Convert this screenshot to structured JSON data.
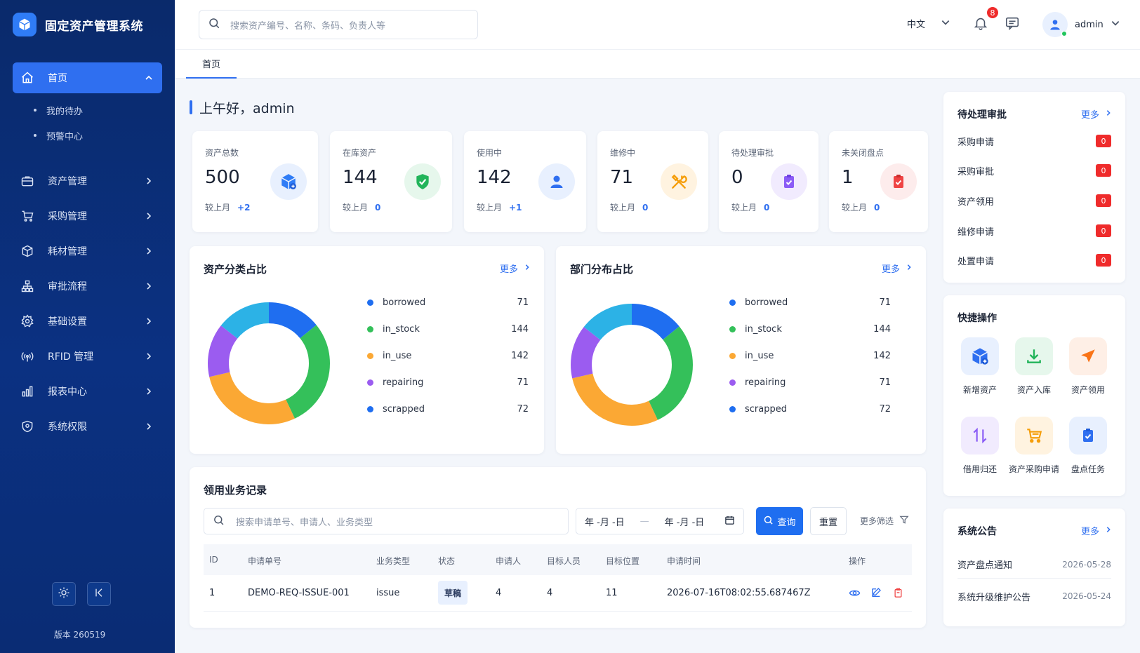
{
  "app": {
    "title": "固定资产管理系统",
    "version": "版本 260519"
  },
  "sidebar": {
    "items": [
      {
        "label": "首页",
        "icon": "home-icon",
        "active": true,
        "children": [
          "我的待办",
          "预警中心"
        ]
      },
      {
        "label": "资产管理",
        "icon": "briefcase-icon"
      },
      {
        "label": "采购管理",
        "icon": "cart-icon"
      },
      {
        "label": "耗材管理",
        "icon": "box-icon"
      },
      {
        "label": "审批流程",
        "icon": "flow-icon"
      },
      {
        "label": "基础设置",
        "icon": "gear-icon"
      },
      {
        "label": "RFID 管理",
        "icon": "rfid-icon"
      },
      {
        "label": "报表中心",
        "icon": "chart-icon"
      },
      {
        "label": "系统权限",
        "icon": "shield-icon"
      }
    ]
  },
  "header": {
    "search_placeholder": "搜索资产编号、名称、条码、负责人等",
    "language": "中文",
    "notification_count": "8",
    "user": "admin"
  },
  "tabs": [
    "首页"
  ],
  "greeting": "上午好，admin",
  "stats": [
    {
      "label": "资产总数",
      "value": "500",
      "compare_label": "较上月",
      "delta": "+2",
      "icon": "cube-icon",
      "color": "#2f7cf6",
      "bg": "#e8f0fe"
    },
    {
      "label": "在库资产",
      "value": "144",
      "compare_label": "较上月",
      "delta": "0",
      "icon": "shield-check-icon",
      "color": "#22b45a",
      "bg": "#e6f7ec"
    },
    {
      "label": "使用中",
      "value": "142",
      "compare_label": "较上月",
      "delta": "+1",
      "icon": "user-icon",
      "color": "#2f6ff0",
      "bg": "#e8f0fe"
    },
    {
      "label": "维修中",
      "value": "71",
      "compare_label": "较上月",
      "delta": "0",
      "icon": "tools-icon",
      "color": "#f59e0b",
      "bg": "#fff3e0"
    },
    {
      "label": "待处理审批",
      "value": "0",
      "compare_label": "较上月",
      "delta": "0",
      "icon": "clipboard-check-icon",
      "color": "#8b5cf6",
      "bg": "#f1ebfe"
    },
    {
      "label": "未关闭盘点",
      "value": "1",
      "compare_label": "较上月",
      "delta": "0",
      "icon": "clipboard-alert-icon",
      "color": "#ef4444",
      "bg": "#fdecec"
    }
  ],
  "more_label": "更多",
  "chart_data": [
    {
      "type": "pie",
      "title": "资产分类占比",
      "categories": [
        "borrowed",
        "in_stock",
        "in_use",
        "repairing",
        "scrapped"
      ],
      "values": [
        71,
        144,
        142,
        71,
        72
      ],
      "colors": [
        "#1f6ef0",
        "#34c05a",
        "#fba834",
        "#9b5cf0",
        "#2cb2e6"
      ],
      "legend_colors": [
        "#1f6ef0",
        "#34c05a",
        "#fba834",
        "#9b5cf0",
        "#1f6ef0"
      ]
    },
    {
      "type": "pie",
      "title": "部门分布占比",
      "categories": [
        "borrowed",
        "in_stock",
        "in_use",
        "repairing",
        "scrapped"
      ],
      "values": [
        71,
        144,
        142,
        71,
        72
      ],
      "colors": [
        "#1f6ef0",
        "#34c05a",
        "#fba834",
        "#9b5cf0",
        "#2cb2e6"
      ],
      "legend_colors": [
        "#1f6ef0",
        "#34c05a",
        "#fba834",
        "#9b5cf0",
        "#1f6ef0"
      ]
    }
  ],
  "approvals": {
    "title": "待处理审批",
    "items": [
      {
        "label": "采购申请",
        "count": "0"
      },
      {
        "label": "采购审批",
        "count": "0"
      },
      {
        "label": "资产领用",
        "count": "0"
      },
      {
        "label": "维修申请",
        "count": "0"
      },
      {
        "label": "处置申请",
        "count": "0"
      }
    ]
  },
  "quick_actions": {
    "title": "快捷操作",
    "items": [
      {
        "label": "新增资产",
        "icon": "cube-plus-icon",
        "color": "#2f6ff0",
        "bg": "#e8f0fe"
      },
      {
        "label": "资产入库",
        "icon": "download-icon",
        "color": "#22b45a",
        "bg": "#e6f7ec"
      },
      {
        "label": "资产领用",
        "icon": "send-icon",
        "color": "#f97316",
        "bg": "#feefe6"
      },
      {
        "label": "借用归还",
        "icon": "swap-icon",
        "color": "#8b5cf6",
        "bg": "#f1ebfe"
      },
      {
        "label": "资产采购申请",
        "icon": "shopping-cart-icon",
        "color": "#f59e0b",
        "bg": "#fff3e0"
      },
      {
        "label": "盘点任务",
        "icon": "clipboard-icon",
        "color": "#2f6ff0",
        "bg": "#e8f0fe"
      }
    ]
  },
  "notices": {
    "title": "系统公告",
    "items": [
      {
        "title": "资产盘点通知",
        "date": "2026-05-28"
      },
      {
        "title": "系统升级维护公告",
        "date": "2026-05-24"
      }
    ]
  },
  "records": {
    "title": "领用业务记录",
    "search_placeholder": "搜索申请单号、申请人、业务类型",
    "date_start": "年 -月 -日",
    "date_end": "年 -月 -日",
    "date_sep": "—",
    "query_label": "查询",
    "reset_label": "重置",
    "more_filter_label": "更多筛选",
    "columns": [
      "ID",
      "申请单号",
      "业务类型",
      "状态",
      "申请人",
      "目标人员",
      "目标位置",
      "申请时间",
      "操作"
    ],
    "rows": [
      {
        "id": "1",
        "no": "DEMO-REQ-ISSUE-001",
        "type": "issue",
        "status": "草稿",
        "applicant": "4",
        "target_user": "4",
        "target_location": "11",
        "time": "2026-07-16T08:02:55.687467Z"
      }
    ]
  }
}
